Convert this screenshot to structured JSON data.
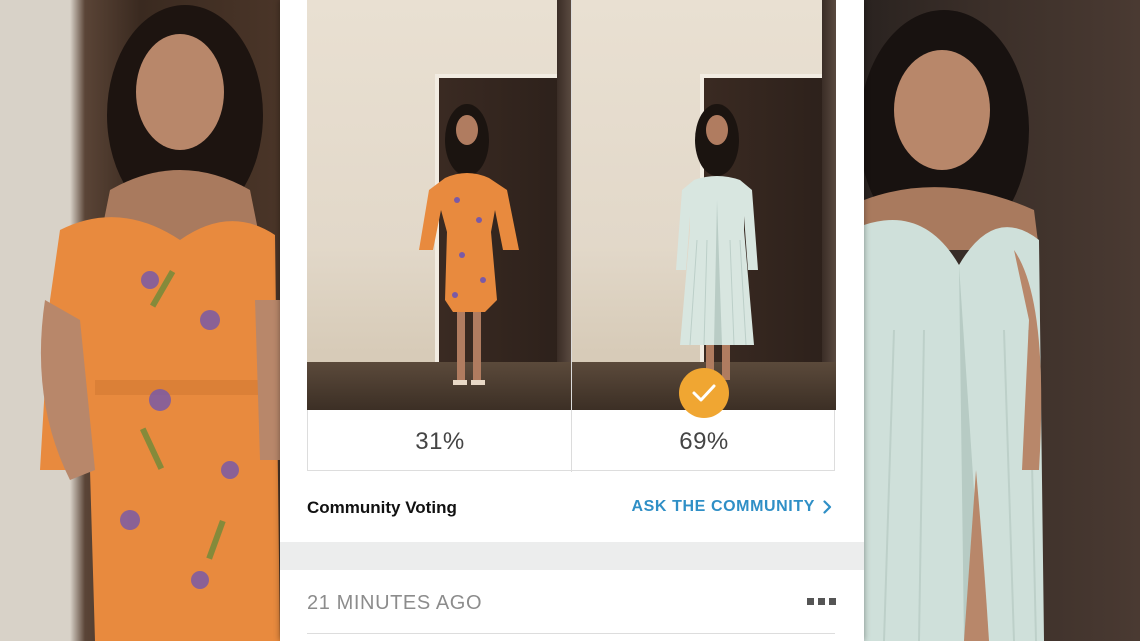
{
  "poll": {
    "option_a_percent": "31%",
    "option_b_percent": "69%",
    "winner": "option_b",
    "option_a_outfit": "orange-floral-dress-photo",
    "option_b_outfit": "mint-pleated-dress-photo"
  },
  "community": {
    "title": "Community Voting",
    "ask_link": "ASK THE COMMUNITY"
  },
  "post": {
    "timestamp": "21 MINUTES AGO"
  },
  "icons": {
    "check": "check-icon",
    "chevron": "chevron-right-icon",
    "more": "more-icon"
  },
  "colors": {
    "accent": "#2f8fc6",
    "badge": "#f0a632"
  }
}
